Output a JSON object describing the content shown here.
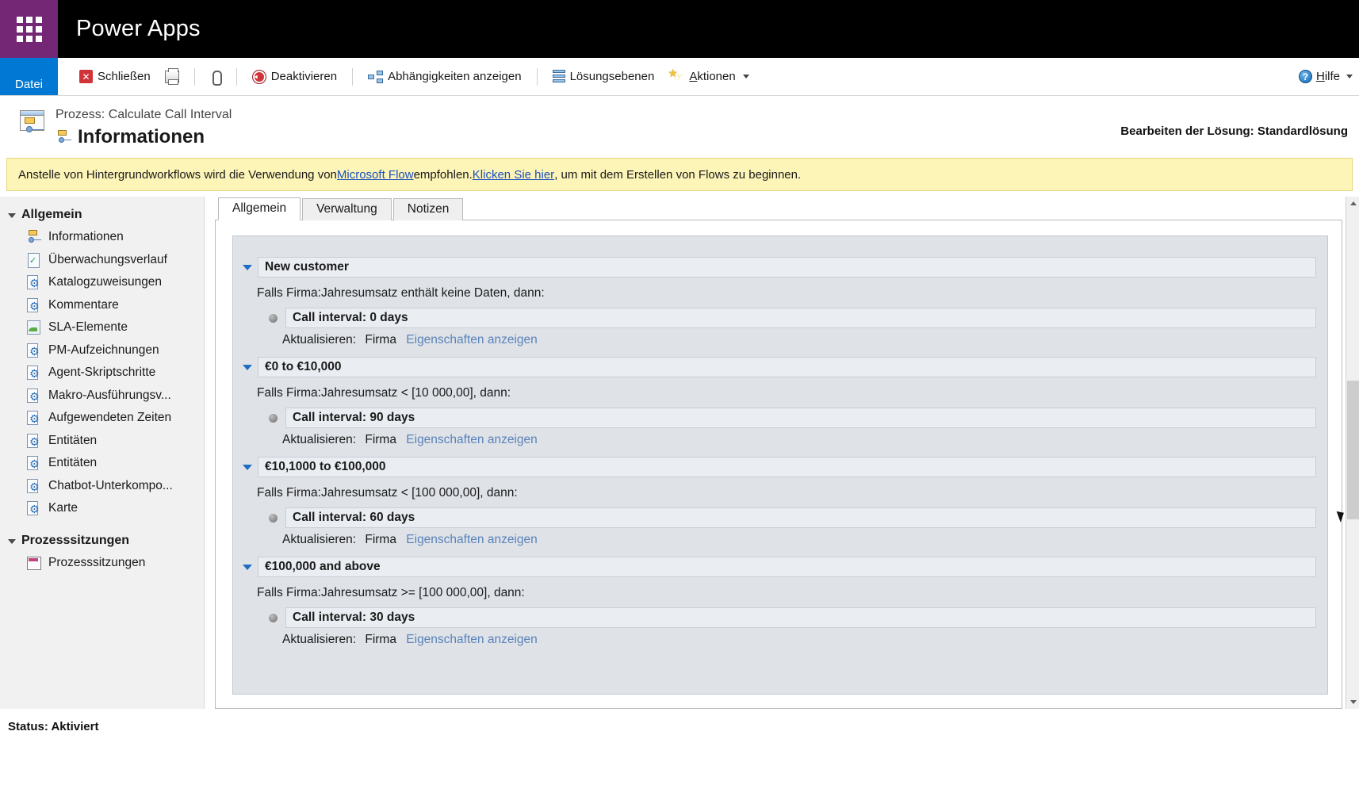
{
  "suite": {
    "waffle_icon": "waffle-grid-icon",
    "title": "Power Apps"
  },
  "ribbon": {
    "file_tab": "Datei",
    "commands": [
      {
        "label": "Schließen",
        "icon": "close-x-icon",
        "mnemonic": "S"
      },
      {
        "label": "",
        "icon": "print-icon"
      },
      {
        "label": "",
        "icon": "paperclip-icon"
      },
      {
        "label": "Deaktivieren",
        "icon": "deactivate-icon"
      },
      {
        "label": "Abhängigkeiten anzeigen",
        "icon": "dependencies-icon"
      },
      {
        "label": "Lösungsebenen",
        "icon": "solution-layers-icon"
      },
      {
        "label": "Aktionen",
        "icon": "actions-star-icon",
        "has_dropdown": true
      }
    ],
    "help": {
      "label": "Hilfe",
      "icon": "help-circle-icon",
      "has_dropdown": true
    }
  },
  "header": {
    "process_label": "Prozess: Calculate Call Interval",
    "page_title": "Informationen",
    "solution_label": "Bearbeiten der Lösung: Standardlösung",
    "process_icon": "process-window-icon",
    "title_icon": "process-node-icon"
  },
  "banner": {
    "text_before": "Anstelle von Hintergrundworkflows wird die Verwendung von ",
    "link1": "Microsoft Flow",
    "text_middle": " empfohlen. ",
    "link2": "Klicken Sie hier",
    "text_after": ", um mit dem Erstellen von Flows zu beginnen.",
    "background_color": "#fdf4b8",
    "link_color": "#1a4fbd"
  },
  "sidebar": {
    "groups": [
      {
        "label": "Allgemein",
        "items": [
          {
            "label": "Informationen",
            "icon": "process-node-icon",
            "icon_type": "proc"
          },
          {
            "label": "Überwachungsverlauf",
            "icon": "audit-document-icon",
            "icon_type": "doc"
          },
          {
            "label": "Katalogzuweisungen",
            "icon": "gear-document-icon",
            "icon_type": "gear"
          },
          {
            "label": "Kommentare",
            "icon": "gear-document-icon",
            "icon_type": "gear"
          },
          {
            "label": "SLA-Elemente",
            "icon": "image-document-icon",
            "icon_type": "img"
          },
          {
            "label": "PM-Aufzeichnungen",
            "icon": "gear-document-icon",
            "icon_type": "gear"
          },
          {
            "label": "Agent-Skriptschritte",
            "icon": "gear-document-icon",
            "icon_type": "gear"
          },
          {
            "label": "Makro-Ausführungsv...",
            "icon": "gear-document-icon",
            "icon_type": "gear"
          },
          {
            "label": "Aufgewendeten Zeiten",
            "icon": "gear-document-icon",
            "icon_type": "gear"
          },
          {
            "label": "Entitäten",
            "icon": "gear-document-icon",
            "icon_type": "gear"
          },
          {
            "label": "Entitäten",
            "icon": "gear-document-icon",
            "icon_type": "gear"
          },
          {
            "label": "Chatbot-Unterkompo...",
            "icon": "gear-document-icon",
            "icon_type": "gear"
          },
          {
            "label": "Karte",
            "icon": "gear-document-icon",
            "icon_type": "gear"
          }
        ]
      },
      {
        "label": "Prozesssitzungen",
        "items": [
          {
            "label": "Prozesssitzungen",
            "icon": "session-grid-icon",
            "icon_type": "sess"
          }
        ]
      }
    ]
  },
  "main": {
    "tabs": [
      {
        "label": "Allgemein",
        "active": true
      },
      {
        "label": "Verwaltung",
        "active": false
      },
      {
        "label": "Notizen",
        "active": false
      }
    ],
    "rules": [
      {
        "title": "New customer",
        "condition": "Falls Firma:Jahresumsatz enthält keine Daten, dann:",
        "action": "Call interval: 0 days",
        "update_label": "Aktualisieren:",
        "update_target": "Firma",
        "update_link": "Eigenschaften anzeigen"
      },
      {
        "title": "€0 to €10,000",
        "condition": "Falls Firma:Jahresumsatz < [10 000,00], dann:",
        "action": "Call interval: 90 days",
        "update_label": "Aktualisieren:",
        "update_target": "Firma",
        "update_link": "Eigenschaften anzeigen"
      },
      {
        "title": "€10,1000 to €100,000",
        "condition": "Falls Firma:Jahresumsatz < [100 000,00], dann:",
        "action": "Call interval: 60 days",
        "update_label": "Aktualisieren:",
        "update_target": "Firma",
        "update_link": "Eigenschaften anzeigen"
      },
      {
        "title": "€100,000 and above",
        "condition": "Falls Firma:Jahresumsatz >= [100 000,00], dann:",
        "action": "Call interval: 30 days",
        "update_label": "Aktualisieren:",
        "update_target": "Firma",
        "update_link": "Eigenschaften anzeigen"
      }
    ]
  },
  "status": {
    "text": "Status: Aktiviert"
  }
}
